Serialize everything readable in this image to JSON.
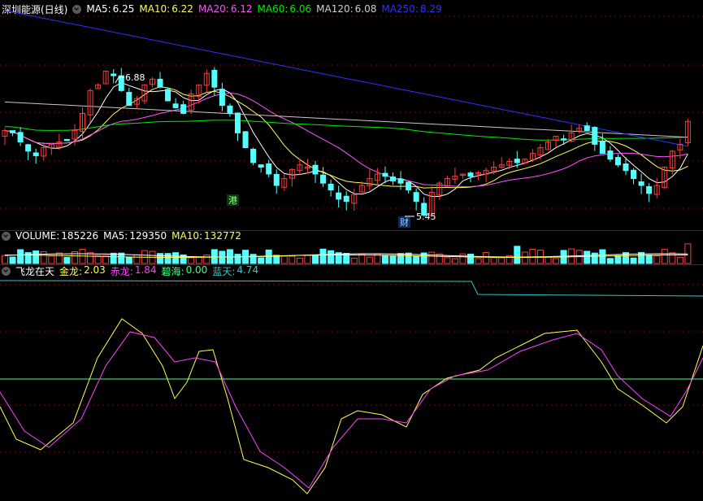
{
  "colors": {
    "background": "#000000",
    "up_candle": "#ff3b3b",
    "down_candle": "#54ffff",
    "ma5": "#ffffff",
    "ma10": "#ffff54",
    "ma20": "#ff54ff",
    "ma60": "#00ee00",
    "ma120": "#c8c8c8",
    "ma250": "#3030ff",
    "grid": "#8b0000",
    "jinlong": "#ffff54",
    "chilong": "#ff40ff",
    "bihai": "#40ff80",
    "lantian": "#30c8c8"
  },
  "price_panel": {
    "title": "深圳能源(日线)",
    "ma5": {
      "label": "MA5:",
      "value": "6.25"
    },
    "ma10": {
      "label": "MA10:",
      "value": "6.22"
    },
    "ma20": {
      "label": "MA20:",
      "value": "6.12"
    },
    "ma60": {
      "label": "MA60:",
      "value": "6.06"
    },
    "ma120": {
      "label": "MA120:",
      "value": "6.08"
    },
    "ma250": {
      "label": "MA250:",
      "value": "8.29"
    },
    "high_label": "6.88",
    "low_label": "5.45",
    "marker_gang": "港",
    "marker_cai": "财"
  },
  "volume_panel": {
    "volume": {
      "label": "VOLUME:",
      "value": "185226"
    },
    "ma5": {
      "label": "MA5:",
      "value": "129350"
    },
    "ma10": {
      "label": "MA10:",
      "value": "132772"
    }
  },
  "indicator_panel": {
    "name": "飞龙在天",
    "jinlong": {
      "label": "金龙:",
      "value": "2.03"
    },
    "chilong": {
      "label": "赤龙:",
      "value": "1.84"
    },
    "bihai": {
      "label": "碧海:",
      "value": "0.00"
    },
    "lantian": {
      "label": "蓝天:",
      "value": "4.74"
    }
  },
  "chart_data": {
    "type": "candlestick",
    "closes": [
      6.2,
      6.18,
      6.1,
      6.02,
      5.98,
      6.05,
      6.08,
      6.1,
      6.12,
      6.2,
      6.35,
      6.55,
      6.6,
      6.72,
      6.68,
      6.55,
      6.42,
      6.48,
      6.6,
      6.65,
      6.58,
      6.46,
      6.4,
      6.35,
      6.52,
      6.6,
      6.7,
      6.58,
      6.42,
      6.35,
      6.18,
      6.05,
      5.92,
      5.88,
      5.82,
      5.72,
      5.78,
      5.86,
      5.9,
      5.88,
      5.82,
      5.74,
      5.68,
      5.6,
      5.58,
      5.64,
      5.72,
      5.78,
      5.82,
      5.8,
      5.76,
      5.74,
      5.68,
      5.58,
      5.46,
      5.66,
      5.74,
      5.78,
      5.8,
      5.82,
      5.8,
      5.83,
      5.85,
      5.88,
      5.9,
      5.93,
      5.92,
      5.95,
      6.0,
      6.05,
      6.1,
      6.15,
      6.12,
      6.18,
      6.22,
      6.2,
      6.08,
      6.0,
      5.95,
      5.9,
      5.85,
      5.78,
      5.72,
      5.65,
      5.72,
      5.88,
      6.02,
      6.08,
      6.28
    ],
    "y_range": [
      5.35,
      7.2
    ]
  }
}
